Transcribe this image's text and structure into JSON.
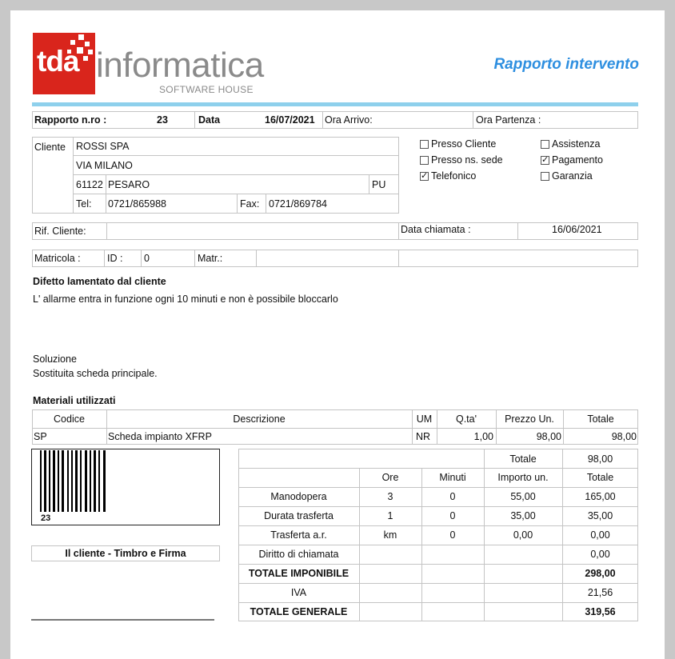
{
  "logo": {
    "brand": "tda",
    "name": "informatica",
    "tagline": "SOFTWARE HOUSE"
  },
  "title": "Rapporto intervento",
  "header": {
    "report_label": "Rapporto n.ro :",
    "report_no": "23",
    "date_label": "Data",
    "date": "16/07/2021",
    "arrival_label": "Ora Arrivo:",
    "departure_label": "Ora Partenza :"
  },
  "client": {
    "label": "Cliente",
    "name": "ROSSI SPA",
    "address": "VIA MILANO",
    "cap": "61122",
    "city": "PESARO",
    "province": "PU",
    "tel_label": "Tel:",
    "tel": "0721/865988",
    "fax_label": "Fax:",
    "fax": "0721/869784"
  },
  "options": {
    "presso_cliente": {
      "label": "Presso Cliente",
      "checked": false
    },
    "presso_sede": {
      "label": "Presso ns. sede",
      "checked": false
    },
    "telefonico": {
      "label": "Telefonico",
      "checked": true
    },
    "assistenza": {
      "label": "Assistenza",
      "checked": false
    },
    "pagamento": {
      "label": "Pagamento",
      "checked": true
    },
    "garanzia": {
      "label": "Garanzia",
      "checked": false
    }
  },
  "ref": {
    "rif_label": "Rif. Cliente:",
    "rif_value": "",
    "call_date_label": "Data chiamata :",
    "call_date": "16/06/2021"
  },
  "matricola": {
    "label": "Matricola :",
    "id_label": "ID :",
    "id": "0",
    "matr_label": "Matr.:"
  },
  "defect": {
    "title": "Difetto lamentato dal cliente",
    "text": "L' allarme entra in funzione ogni 10 minuti e non è possibile bloccarlo"
  },
  "solution": {
    "title": "Soluzione",
    "text": "Sostituita scheda principale."
  },
  "materials": {
    "title": "Materiali utilizzati",
    "headers": [
      "Codice",
      "Descrizione",
      "UM",
      "Q.ta'",
      "Prezzo Un.",
      "Totale"
    ],
    "rows": [
      [
        "SP",
        "Scheda impianto XFRP",
        "NR",
        "1,00",
        "98,00",
        "98,00"
      ]
    ]
  },
  "barcode_value": "23",
  "signature_label": "Il cliente - Timbro e Firma",
  "costs": {
    "total_label": "Totale",
    "total_materials": "98,00",
    "headers": [
      "Ore",
      "Minuti",
      "Importo un.",
      "Totale"
    ],
    "rows": [
      {
        "label": "Manodopera",
        "ore": "3",
        "minuti": "0",
        "importo": "55,00",
        "totale": "165,00"
      },
      {
        "label": "Durata trasferta",
        "ore": "1",
        "minuti": "0",
        "importo": "35,00",
        "totale": "35,00"
      },
      {
        "label": "Trasferta a.r.",
        "ore": "km",
        "minuti": "0",
        "importo": "0,00",
        "totale": "0,00"
      },
      {
        "label": "Diritto di chiamata",
        "ore": "",
        "minuti": "",
        "importo": "",
        "totale": "0,00"
      }
    ],
    "imponibile_label": "TOTALE IMPONIBILE",
    "imponibile": "298,00",
    "iva_label": "IVA",
    "iva": "21,56",
    "generale_label": "TOTALE GENERALE",
    "generale": "319,56"
  }
}
